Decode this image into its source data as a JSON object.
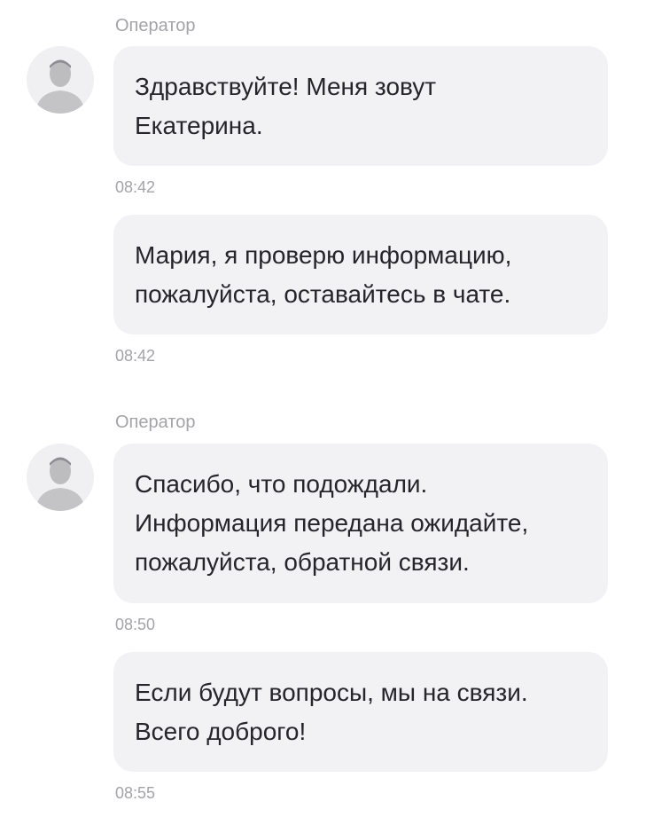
{
  "chat": {
    "groups": [
      {
        "sender": "Оператор",
        "messages": [
          {
            "text": "Здравствуйте! Меня зовут\nЕкатерина.",
            "time": "08:42"
          },
          {
            "text": "Мария, я проверю информацию,\nпожалуйста, оставайтесь в чате.",
            "time": "08:42"
          }
        ]
      },
      {
        "sender": "Оператор",
        "messages": [
          {
            "text": "Спасибо, что подождали.\nИнформация передана ожидайте,\nпожалуйста, обратной связи.",
            "time": "08:50"
          },
          {
            "text": "Если будут вопросы, мы на связи.\nВсего доброго!",
            "time": "08:55"
          }
        ]
      }
    ]
  },
  "icons": {
    "avatar": "operator-avatar-icon"
  },
  "colors": {
    "bubble_bg": "#f2f2f5",
    "meta_text": "#a3a3a8",
    "message_text": "#26262a",
    "avatar_bg": "#f0f0f2",
    "avatar_figure": "#bdbdc0"
  }
}
